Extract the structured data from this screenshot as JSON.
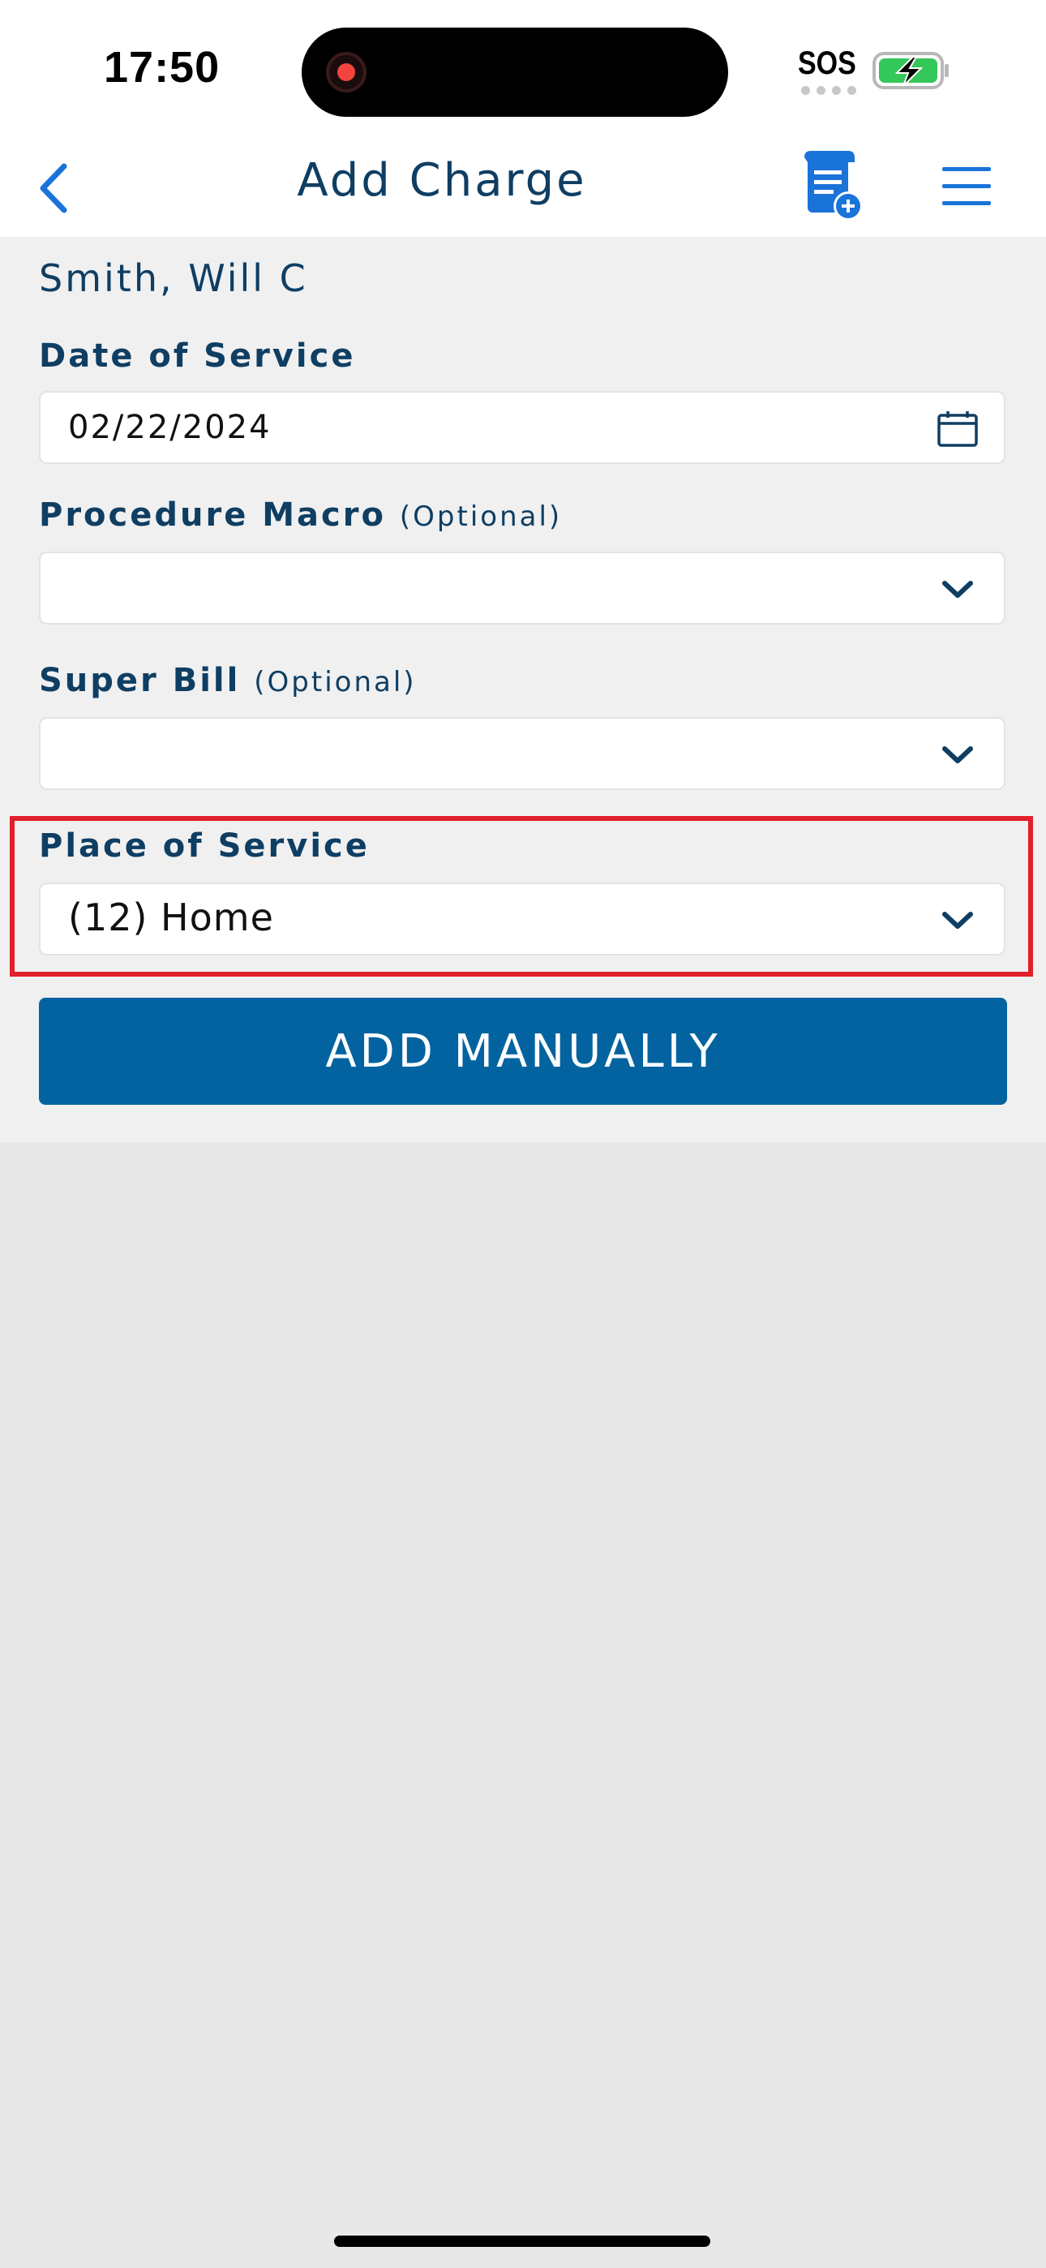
{
  "status_bar": {
    "time": "17:50",
    "carrier_status": "SOS"
  },
  "header": {
    "title": "Add Charge",
    "back_icon": "chevron-left-icon",
    "doc_icon": "document-add-icon",
    "menu_icon": "hamburger-menu-icon"
  },
  "form": {
    "patient_name": "Smith, Will C",
    "date_of_service": {
      "label": "Date of Service",
      "value": "02/22/2024",
      "icon": "calendar-icon"
    },
    "procedure_macro": {
      "label": "Procedure Macro",
      "optional_note": "(Optional)",
      "value": "",
      "icon": "chevron-down-icon"
    },
    "super_bill": {
      "label": "Super Bill",
      "optional_note": "(Optional)",
      "value": "",
      "icon": "chevron-down-icon"
    },
    "place_of_service": {
      "label": "Place of Service",
      "value": "(12) Home",
      "icon": "chevron-down-icon"
    },
    "add_button_label": "ADD MANUALLY"
  },
  "colors": {
    "primary_text": "#0f3e63",
    "accent_blue": "#1a73d9",
    "button_bg": "#0263a0",
    "highlight_border": "#e0202a",
    "battery_green": "#34c759"
  }
}
